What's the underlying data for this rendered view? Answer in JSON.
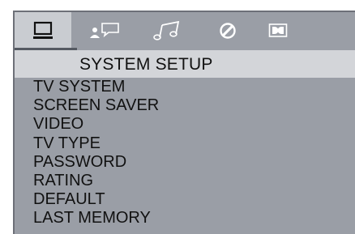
{
  "tabs": [
    {
      "icon": "monitor-icon",
      "active": true
    },
    {
      "icon": "person-speech-icon",
      "active": false
    },
    {
      "icon": "music-note-icon",
      "active": false
    },
    {
      "icon": "slashed-circle-icon",
      "active": false
    },
    {
      "icon": "dolby-icon",
      "active": false
    }
  ],
  "header": {
    "title": "SYSTEM SETUP"
  },
  "menu": {
    "items": [
      "TV SYSTEM",
      "SCREEN SAVER",
      "VIDEO",
      "TV TYPE",
      "PASSWORD",
      "RATING",
      "DEFAULT",
      "LAST MEMORY"
    ]
  },
  "colors": {
    "panel": "#9a9ea6",
    "header": "#d3d5d9",
    "active_tab": "#c9ccd1",
    "text": "#111111"
  }
}
